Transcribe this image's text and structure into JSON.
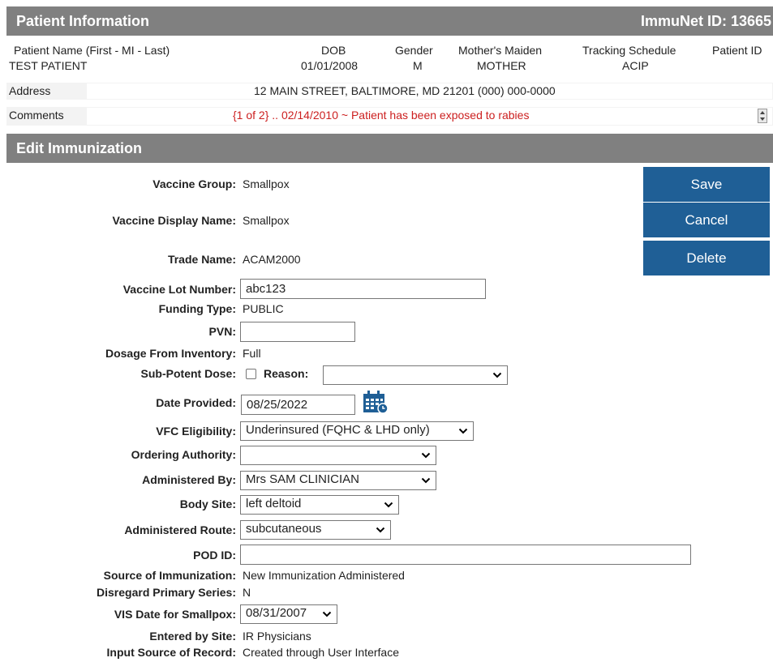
{
  "patient_info": {
    "title": "Patient Information",
    "immunet_id_label": "ImmuNet ID: 13665",
    "headers": [
      "Patient Name (First - MI - Last)",
      "DOB",
      "Gender",
      "Mother's Maiden",
      "Tracking Schedule",
      "Patient ID"
    ],
    "values": {
      "name": "TEST PATIENT",
      "dob": "01/01/2008",
      "gender": "M",
      "mothers_maiden": "MOTHER",
      "tracking_schedule": "ACIP",
      "patient_id": ""
    },
    "address_label": "Address",
    "address": "12 MAIN STREET, BALTIMORE, MD 21201 (000) 000-0000",
    "comments_label": "Comments",
    "comment": "{1 of 2} .. 02/14/2010 ~ Patient has been exposed to rabies"
  },
  "edit_immunization": {
    "title": "Edit Immunization",
    "buttons": {
      "save": "Save",
      "cancel": "Cancel",
      "delete": "Delete"
    },
    "fields": {
      "vaccine_group": {
        "label": "Vaccine Group:",
        "value": "Smallpox"
      },
      "vaccine_display_name": {
        "label": "Vaccine Display Name:",
        "value": "Smallpox"
      },
      "trade_name": {
        "label": "Trade Name:",
        "value": "ACAM2000"
      },
      "vaccine_lot_number": {
        "label": "Vaccine Lot Number:",
        "value": "abc123"
      },
      "funding_type": {
        "label": "Funding Type:",
        "value": "PUBLIC"
      },
      "pvn": {
        "label": "PVN:",
        "value": ""
      },
      "dosage_from_inventory": {
        "label": "Dosage From Inventory:",
        "value": "Full"
      },
      "sub_potent_dose": {
        "label": "Sub-Potent Dose:",
        "checked": false
      },
      "reason": {
        "label": "Reason:",
        "value": ""
      },
      "date_provided": {
        "label": "Date Provided:",
        "value": "08/25/2022"
      },
      "vfc_eligibility": {
        "label": "VFC Eligibility:",
        "value": "Underinsured (FQHC & LHD only)"
      },
      "ordering_authority": {
        "label": "Ordering Authority:",
        "value": ""
      },
      "administered_by": {
        "label": "Administered By:",
        "value": "Mrs SAM CLINICIAN"
      },
      "body_site": {
        "label": "Body Site:",
        "value": "left deltoid"
      },
      "administered_route": {
        "label": "Administered Route:",
        "value": "subcutaneous"
      },
      "pod_id": {
        "label": "POD ID:",
        "value": ""
      },
      "source_of_immunization": {
        "label": "Source of Immunization:",
        "value": "New Immunization Administered"
      },
      "disregard_primary_series": {
        "label": "Disregard Primary Series:",
        "value": "N"
      },
      "vis_date": {
        "label": "VIS Date for Smallpox:",
        "value": "08/31/2007"
      },
      "entered_by_site": {
        "label": "Entered by Site:",
        "value": "IR Physicians"
      },
      "input_source": {
        "label": "Input Source of Record:",
        "value": "Created through User Interface"
      }
    }
  },
  "colors": {
    "header_bar": "#808080",
    "button": "#1f5f96",
    "comment_text": "#cc1f1f",
    "calendar_icon": "#1f5f96"
  },
  "icons": {
    "calendar": "calendar-icon",
    "dropdown": "chevron-down-icon",
    "scroll": "scroll-spinner-icon"
  }
}
